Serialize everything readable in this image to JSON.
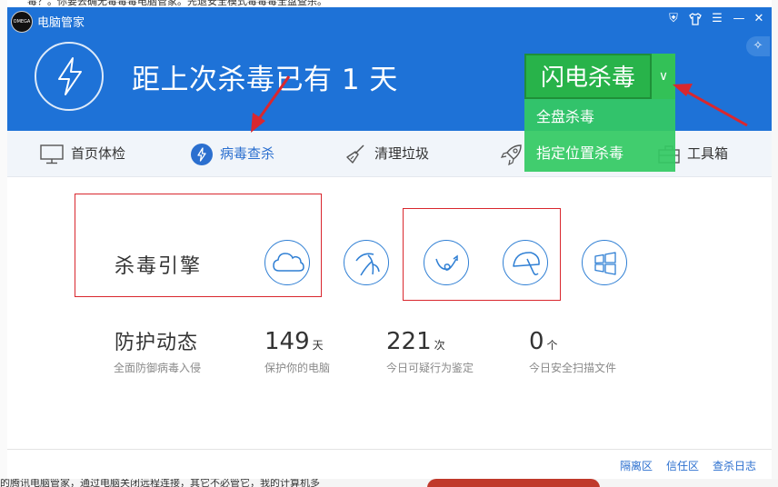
{
  "background": {
    "top_text": "毒？。你要去确无毒毒毒电脑管家。先退安全模式毒毒毒全盘查杀。",
    "bottom_text": "的腾讯电脑管家，通过电脑关闭远程连接，其它不必管它，我的计算机多"
  },
  "window": {
    "title": "电脑管家",
    "logo_text": "OMEGA"
  },
  "controls": {
    "shield": "⛨",
    "shirt": "👕",
    "menu": "☰",
    "minimize": "—",
    "close": "✕",
    "assistant": "✧"
  },
  "header": {
    "headline": "距上次杀毒已有 1 天"
  },
  "scan": {
    "main_label": "闪电杀毒",
    "arrow": "∨",
    "options": [
      "全盘杀毒",
      "指定位置杀毒"
    ]
  },
  "nav": {
    "items": [
      {
        "label": "首页体检"
      },
      {
        "label": "病毒查杀"
      },
      {
        "label": "清理垃圾"
      },
      {
        "label": "工具箱"
      }
    ]
  },
  "engines": {
    "label": "杀毒引擎",
    "icons": [
      "cloud-engine-icon",
      "fan-engine-icon",
      "behavior-engine-icon",
      "umbrella-engine-icon",
      "windows-engine-icon"
    ]
  },
  "stats": {
    "title": "防护动态",
    "subtitle": "全面防御病毒入侵",
    "items": [
      {
        "value": "149",
        "unit": "天",
        "desc": "保护你的电脑"
      },
      {
        "value": "221",
        "unit": "次",
        "desc": "今日可疑行为鉴定"
      },
      {
        "value": "0",
        "unit": "个",
        "desc": "今日安全扫描文件"
      }
    ]
  },
  "footer": {
    "links": [
      "隔离区",
      "信任区",
      "查杀日志"
    ]
  },
  "colors": {
    "header_blue": "#1e72d7",
    "scan_green": "#28b34a",
    "accent_blue": "#2b6fcf",
    "annotation_red": "#d9272e"
  }
}
